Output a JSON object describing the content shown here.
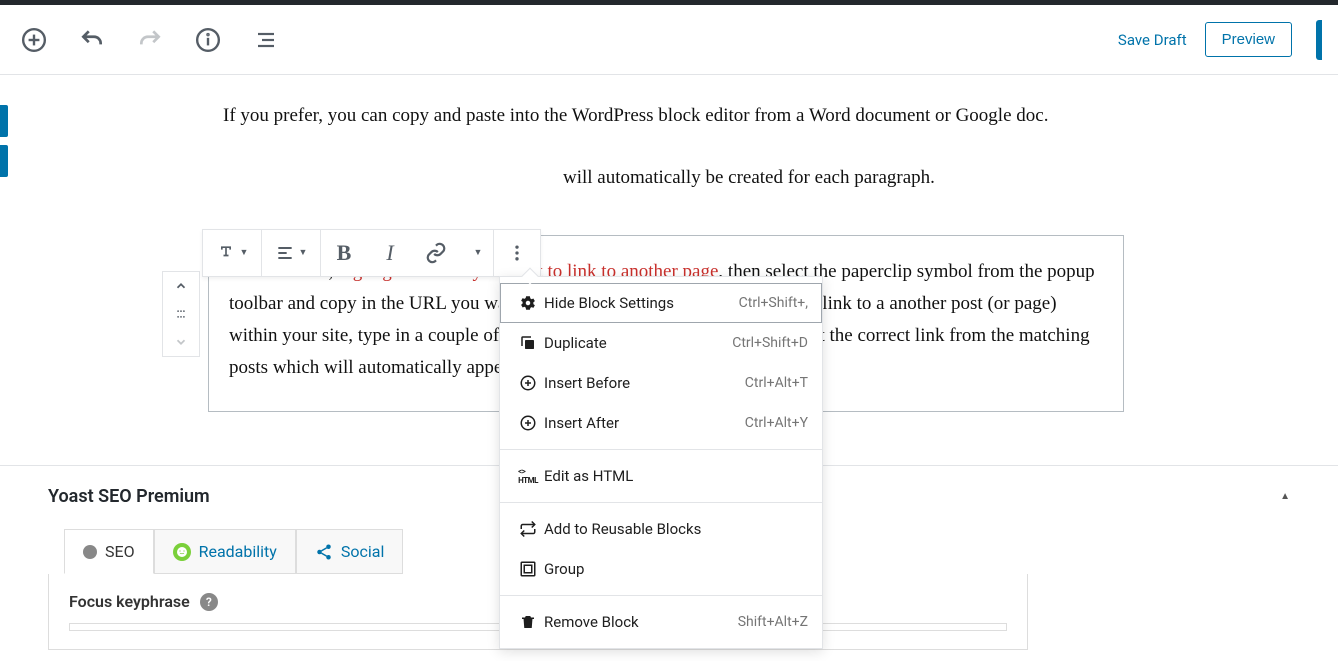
{
  "header": {
    "save_draft": "Save Draft",
    "preview": "Preview"
  },
  "content": {
    "para1": "If you prefer,  you can copy and paste into the WordPress block editor from a Word document or Google doc.",
    "para2_suffix": " will automatically be created for each paragraph.",
    "block_para": {
      "pre": " To add a link, ",
      "highlight": "highlight the text you want to link to another page",
      "post": ", then select the paperclip symbol from the popup toolbar and copy in the URL you want to link to. Alternatively, if you want to link to a another post (or page) within your site, type in a couple of words from the title of that post and select the correct link from the matching posts which will automatically appear."
    }
  },
  "dropdown": {
    "items": [
      {
        "icon": "gear",
        "label": "Hide Block Settings",
        "shortcut": "Ctrl+Shift+,"
      },
      {
        "icon": "copy",
        "label": "Duplicate",
        "shortcut": "Ctrl+Shift+D"
      },
      {
        "icon": "insert-before",
        "label": "Insert Before",
        "shortcut": "Ctrl+Alt+T"
      },
      {
        "icon": "insert-after",
        "label": "Insert After",
        "shortcut": "Ctrl+Alt+Y"
      },
      {
        "icon": "html",
        "label": "Edit as HTML",
        "shortcut": ""
      },
      {
        "icon": "reusable",
        "label": "Add to Reusable Blocks",
        "shortcut": ""
      },
      {
        "icon": "group",
        "label": "Group",
        "shortcut": ""
      },
      {
        "icon": "trash",
        "label": "Remove Block",
        "shortcut": "Shift+Alt+Z"
      }
    ]
  },
  "yoast": {
    "title": "Yoast SEO Premium",
    "tabs": {
      "seo": "SEO",
      "readability": "Readability",
      "social": "Social"
    },
    "focus_keyphrase": "Focus keyphrase"
  }
}
